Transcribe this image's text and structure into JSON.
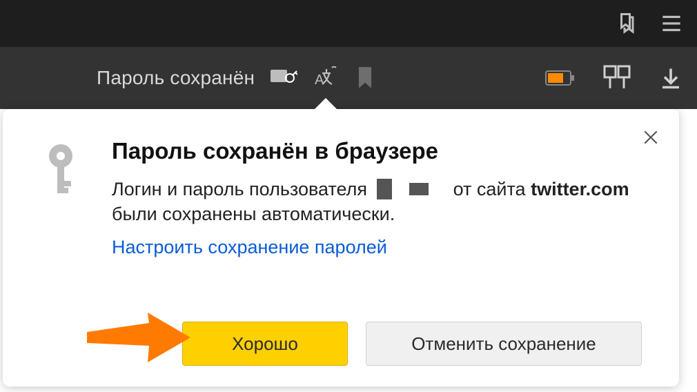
{
  "topbar": {
    "bookmarks_icon": "bookmarks-icon",
    "menu_icon": "menu-icon"
  },
  "secondbar": {
    "status_text": "Пароль сохранён",
    "icons": {
      "card_key": "card-key-icon",
      "translate": "translate-icon",
      "bookmark": "bookmark-flat-icon",
      "battery": "battery-icon",
      "extensions": "extensions-panel-icon",
      "download": "download-icon"
    }
  },
  "popup": {
    "title": "Пароль сохранён в браузере",
    "body_prefix": "Логин и пароль пользователя",
    "body_mid": "от сайта",
    "site": "twitter.com",
    "body_suffix": "были сохранены автоматически.",
    "settings_link": "Настроить сохранение паролей",
    "ok_label": "Хорошо",
    "cancel_label": "Отменить сохранение"
  }
}
